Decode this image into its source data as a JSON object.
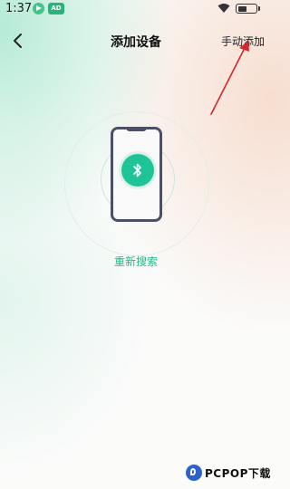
{
  "status_bar": {
    "time": "1:37",
    "icons": [
      "app-notification-icon",
      "app-badge-icon",
      "wifi-icon",
      "battery-icon"
    ]
  },
  "nav": {
    "back_icon": "chevron-left-icon",
    "title": "添加设备",
    "manual_add_label": "手动添加"
  },
  "main": {
    "illustration_icon": "bluetooth-icon",
    "rescan_label": "重新搜索"
  },
  "watermark": {
    "text": "PCPOP下载"
  },
  "colors": {
    "accent": "#1fc496",
    "phone_outline": "#4b5066",
    "annotation_arrow": "#d8262d"
  }
}
